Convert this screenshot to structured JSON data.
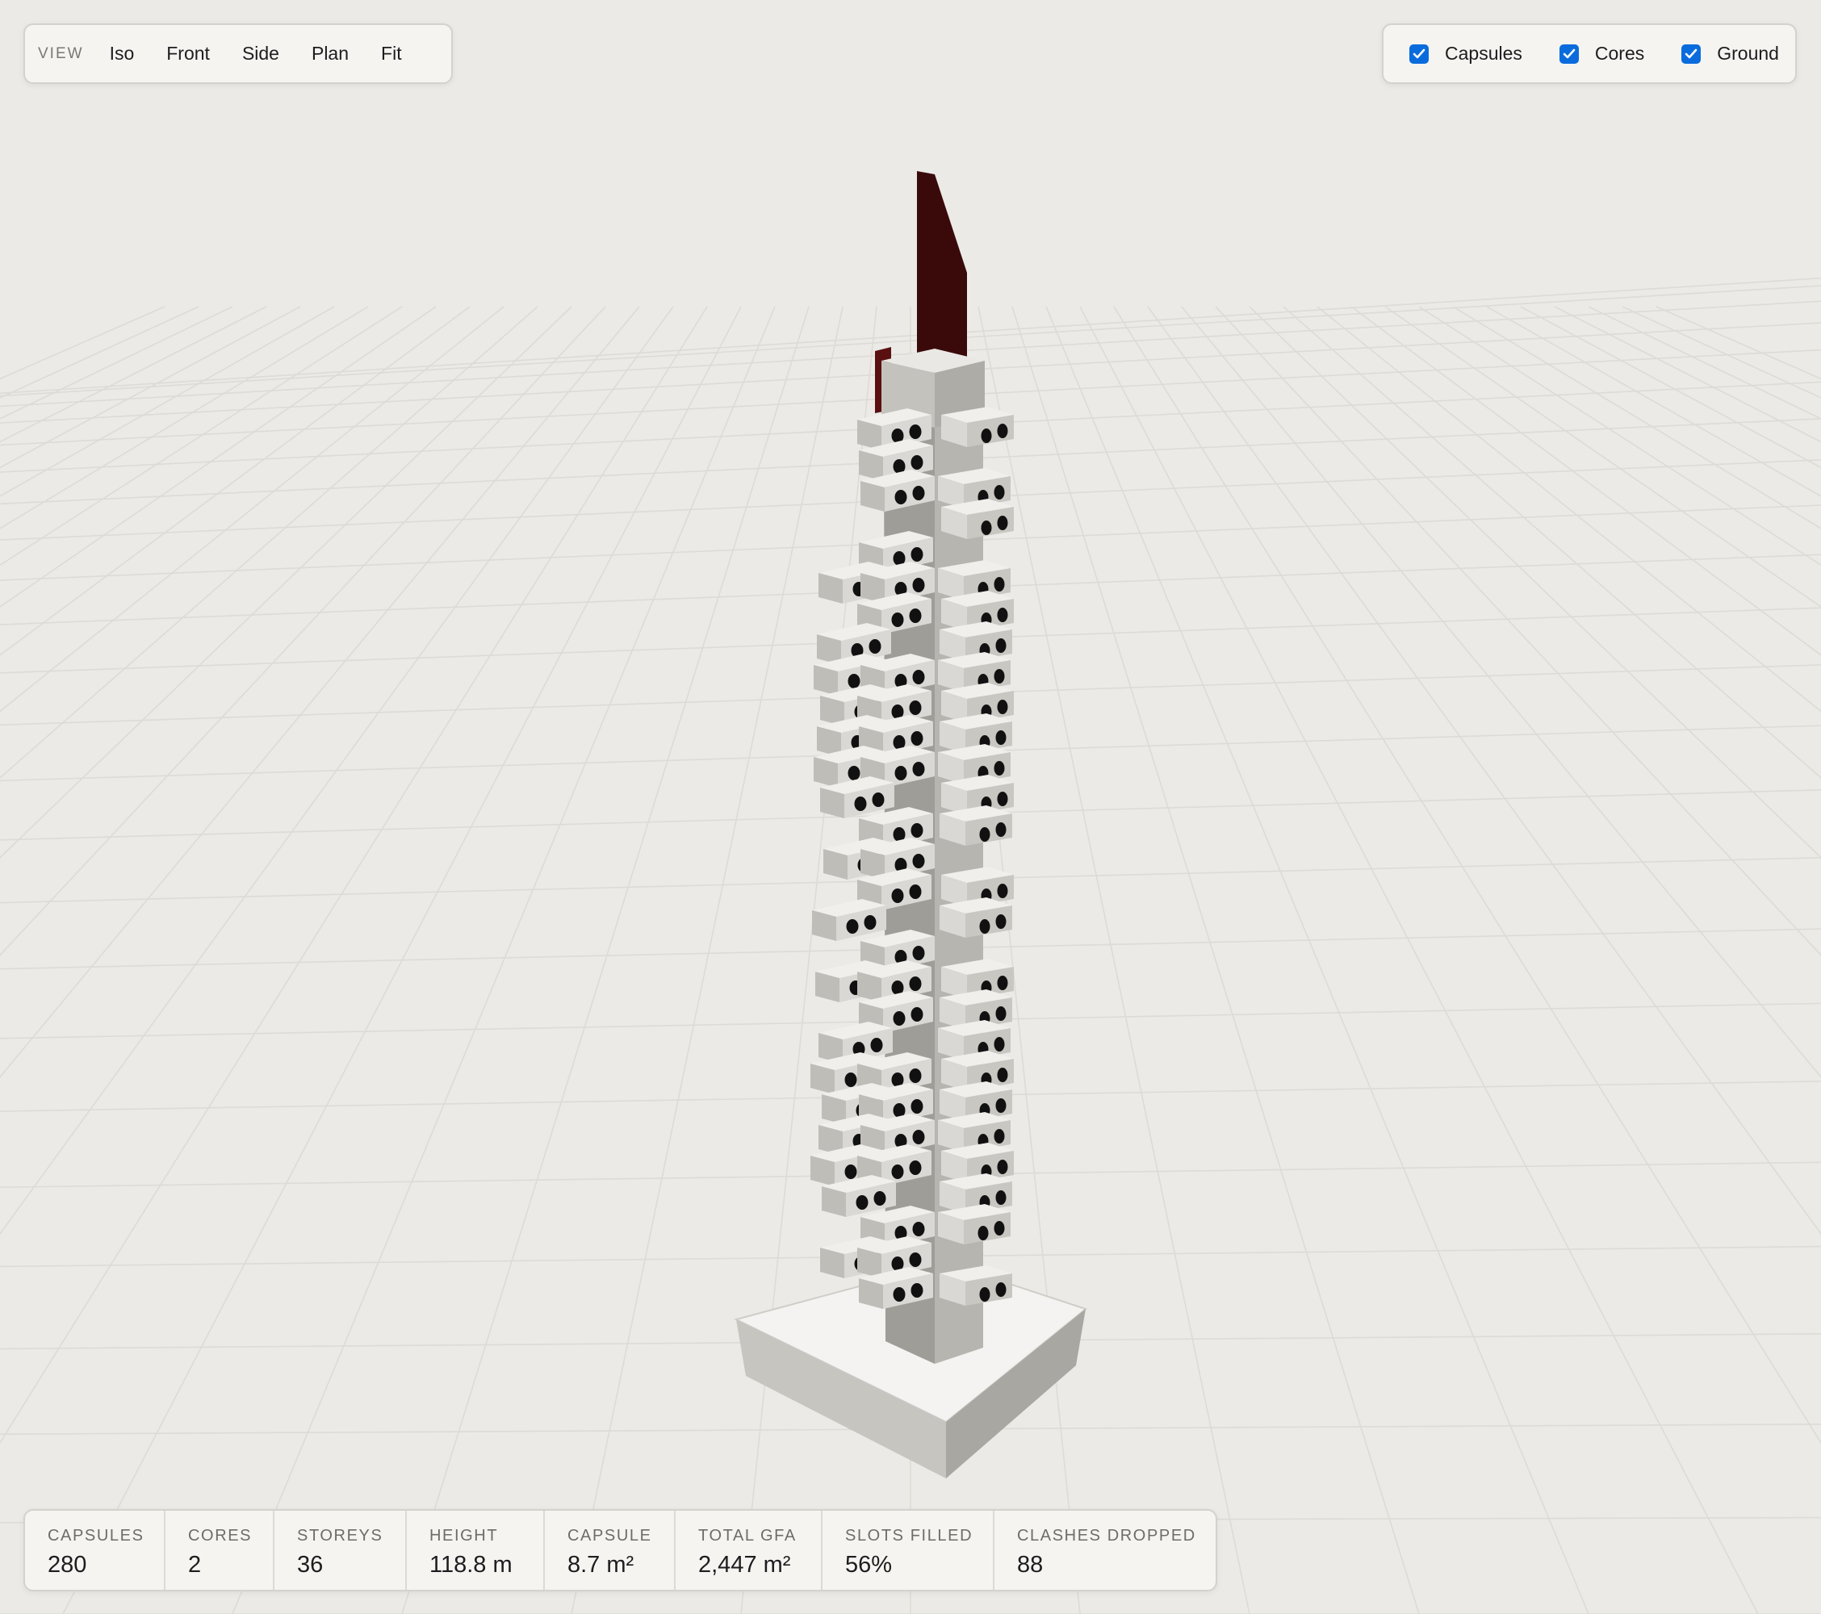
{
  "view_toolbar": {
    "label": "VIEW",
    "buttons": [
      "Iso",
      "Front",
      "Side",
      "Plan",
      "Fit"
    ]
  },
  "layer_toggles": [
    {
      "label": "Capsules",
      "checked": true
    },
    {
      "label": "Cores",
      "checked": true
    },
    {
      "label": "Ground",
      "checked": true
    }
  ],
  "stats": [
    {
      "label": "CAPSULES",
      "value": "280"
    },
    {
      "label": "CORES",
      "value": "2"
    },
    {
      "label": "STOREYS",
      "value": "36"
    },
    {
      "label": "HEIGHT",
      "value": "118.8 m"
    },
    {
      "label": "CAPSULE",
      "value": "8.7 m²"
    },
    {
      "label": "TOTAL GFA",
      "value": "2,447 m²"
    },
    {
      "label": "SLOTS FILLED",
      "value": "56%"
    },
    {
      "label": "CLASHES DROPPED",
      "value": "88"
    }
  ],
  "colors": {
    "background": "#ebeae6",
    "capsule": "#d9d8d4",
    "core": "#b2b0ab",
    "roof_fin": "#3a0a0a",
    "checkbox": "#0a6cdc"
  }
}
